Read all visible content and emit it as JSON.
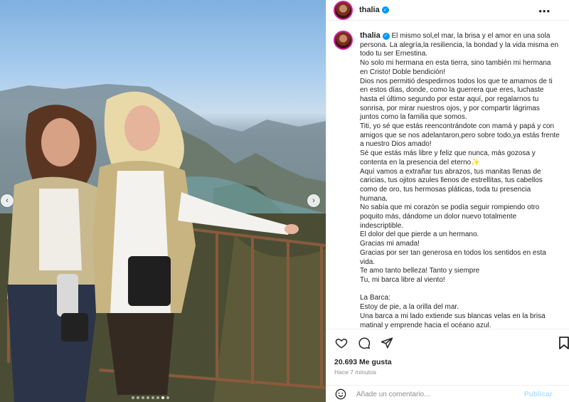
{
  "post": {
    "username": "thalia",
    "verified_symbol": "✓",
    "more_icon": "•••",
    "caption": "El mismo sol,el mar, la brisa y el amor en una sola persona. La alegría,la resiliencia, la bondad y la vida misma en todo tu ser Ernestina.\nNo solo mi hermana en esta tierra, sino también mi hermana en Cristo! Doble bendición!\nDios nos permitió despedirnos todos los que te amamos de ti en estos días, donde, como la guerrera que eres, luchaste hasta el último segundo por estar aquí, por regalarnos tu sonrisa, por mirar nuestros ojos, y por compartir lágrimas juntos como la familia que somos.\nTiti, yo sé que estás reencontrándote con mamá y papá y con amigos que se nos adelantaron,pero sobre todo,ya estás frente a nuestro Dios amado!\nSé que estás más libre y feliz que nunca, más gozosa y contenta en la presencia del eterno✨\nAquí vamos a extrañar tus abrazos, tus manitas llenas de caricias, tus ojitos azules llenos de estrellitas, tus cabellos como de oro, tus hermosas pláticas, toda tu presencia humana.\nNo sabía que mi corazón se podía seguir rompiendo otro poquito más, dándome un dolor nuevo totalmente indescriptible.\nEl dolor del que pierde a un hermano.\nGracias mi amada!\nGracias por ser tan generosa en todos los sentidos en esta vida.\nTe amo tanto belleza! Tanto y siempre\nTu, mi barca libre al viento!\n\nLa Barca:\nEstoy de pie, a la orilla del mar.\nUna barca a mi lado extiende sus blancas velas en la brisa matinal y emprende hacia el océano azul.\nEs un objeto de fuerza y belleza.\nDe pie la observo hasta que cuelga como un pellizco de blanca",
    "likes": "20.693 Me gusta",
    "time_ago": "Hace 7 minutos",
    "comment_placeholder": "Añade un comentario...",
    "publish_label": "Publicar"
  },
  "carousel": {
    "prev_symbol": "‹",
    "next_symbol": "›",
    "slide_count": 8,
    "active_slide": 6
  },
  "colors": {
    "verified": "#0095f6",
    "publish_disabled": "#b2dffc",
    "story_ring": "#d6249f"
  }
}
